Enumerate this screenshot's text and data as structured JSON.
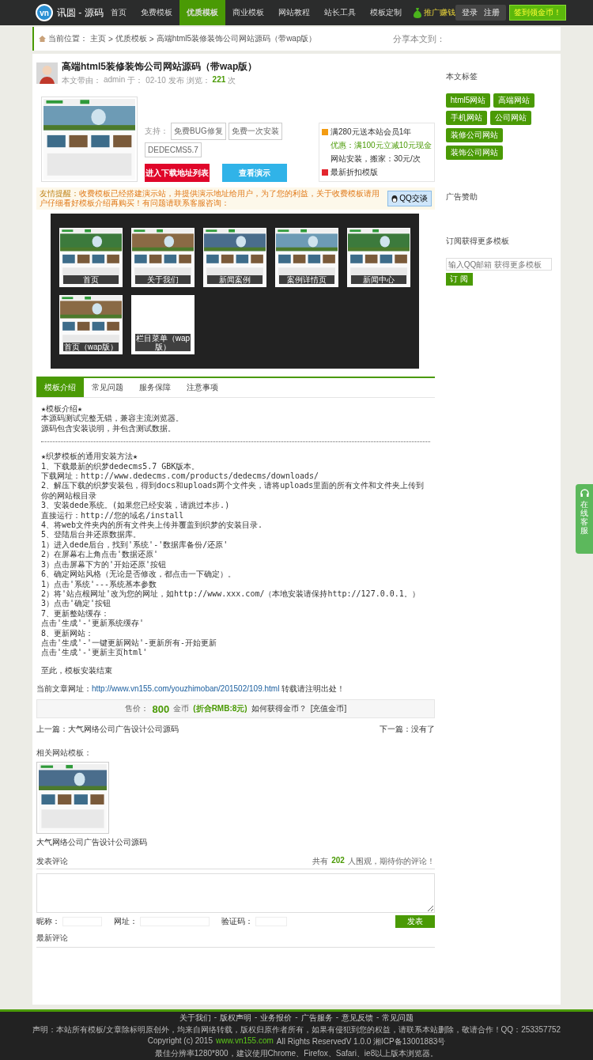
{
  "header": {
    "logo_mark": "vn",
    "logo_text": "讯圆 - 源码",
    "nav": [
      {
        "label": "首页",
        "selected": false
      },
      {
        "label": "免费模板",
        "selected": false
      },
      {
        "label": "优质模板",
        "selected": true
      },
      {
        "label": "商业模板",
        "selected": false
      },
      {
        "label": "网站教程",
        "selected": false
      },
      {
        "label": "站长工具",
        "selected": false
      },
      {
        "label": "模板定制",
        "selected": false
      }
    ],
    "promo": "推广赚钱",
    "login": "登录",
    "register": "注册",
    "signin": "签到领金币！"
  },
  "breadcrumb": {
    "label": "当前位置：",
    "separator": ">",
    "items": [
      "主页",
      "优质模板",
      "高端html5装修装饰公司网站源码（带wap版）"
    ],
    "share": "分享本文到："
  },
  "article": {
    "title": "高端html5装修装饰公司网站源码（带wap版）",
    "meta": {
      "author_label": "本文带由：",
      "author": "admin",
      "date_label": "于：",
      "date": "02-10 发布",
      "views_label": "浏览：",
      "views": "221",
      "views_unit": "次"
    },
    "support_label": "支持：",
    "support": [
      "免费BUG修复",
      "免费一次安装",
      "DEDECMS5.7"
    ],
    "download_button": "进入下载地址列表",
    "demo_button": "查看演示",
    "offers": [
      {
        "kind": "gift",
        "text": "满280元送本站会员1年"
      },
      {
        "kind": "highlight",
        "text": "优惠：满100元立减10元现金"
      },
      {
        "kind": "plain",
        "text": "网站安装，搬家：30元/次"
      },
      {
        "kind": "discount",
        "text": "最新折扣模版"
      }
    ],
    "notice": {
      "label": "友情提醒：",
      "text": "收费模板已经搭建演示站，并提供演示地址给用户，为了您的利益，关于收费模板请用户仔细看好模板介绍再购买！有问题请联系客服咨询：",
      "qq_button": "QQ交谈"
    },
    "gallery": [
      {
        "caption": "首页"
      },
      {
        "caption": "关于我们"
      },
      {
        "caption": "新闻案例"
      },
      {
        "caption": "案例详情页"
      },
      {
        "caption": "新闻中心"
      },
      {
        "caption": "首页（wap版）"
      },
      {
        "caption": "栏目菜单（wap版）"
      }
    ],
    "tabs": [
      {
        "label": "模板介绍",
        "selected": true
      },
      {
        "label": "常见问题",
        "selected": false
      },
      {
        "label": "服务保障",
        "selected": false
      },
      {
        "label": "注意事项",
        "selected": false
      }
    ],
    "content": [
      {
        "kind": "text",
        "text": "★模板介绍★"
      },
      {
        "kind": "text",
        "text": "本源码测试完整无错，兼容主流浏览器。"
      },
      {
        "kind": "text",
        "text": "源码包含安装说明，并包含测试数据。"
      },
      {
        "kind": "divider"
      },
      {
        "kind": "text",
        "text": "★织梦模板的通用安装方法★"
      },
      {
        "kind": "text",
        "text": "1、下载最新的织梦dedecms5.7 GBK版本。"
      },
      {
        "kind": "text",
        "text": "下载网址：http://www.dedecms.com/products/dedecms/downloads/"
      },
      {
        "kind": "text",
        "text": "2、解压下载的织梦安装包，得到docs和uploads两个文件夹，请将uploads里面的所有文件和文件夹上传到你的网站根目录"
      },
      {
        "kind": "text",
        "text": "3、安装dede系统。(如果您已经安装，请跳过本步.)"
      },
      {
        "kind": "text",
        "text": "直接运行：http://您的域名/install"
      },
      {
        "kind": "text",
        "text": "4、将web文件夹内的所有文件夹上传并覆盖到织梦的安装目录."
      },
      {
        "kind": "text",
        "text": "5、登陆后台并还原数据库。"
      },
      {
        "kind": "text",
        "text": "1）进入dede后台，找到'系统'-'数据库备份/还原'"
      },
      {
        "kind": "text",
        "text": "2）在屏幕右上角点击'数据还原'"
      },
      {
        "kind": "text",
        "text": "3）点击屏幕下方的'开始还原'按钮"
      },
      {
        "kind": "text",
        "text": "6、确定网站风格（无论是否修改，都点击一下确定）。"
      },
      {
        "kind": "text",
        "text": "1）点击'系统'---系统基本参数"
      },
      {
        "kind": "text",
        "text": "2）将'站点根网址'改为您的网址，如http://www.xxx.com/（本地安装请保持http://127.0.0.1。）"
      },
      {
        "kind": "text",
        "text": "3）点击'确定'按钮"
      },
      {
        "kind": "text",
        "text": "7、更新整站缓存："
      },
      {
        "kind": "text",
        "text": "点击'生成'-'更新系统缓存'"
      },
      {
        "kind": "text",
        "text": "8、更新网站："
      },
      {
        "kind": "text",
        "text": "点击'生成'-'一键更新网站'-更新所有-开始更新"
      },
      {
        "kind": "text",
        "text": "点击'生成'-'更新主页html'"
      },
      {
        "kind": "gap"
      },
      {
        "kind": "text",
        "text": "至此，模板安装结束"
      }
    ],
    "source": {
      "label": "当前文章网址：",
      "url": "http://www.vn155.com/youzhimoban/201502/109.html",
      "note": "转载请注明出处！"
    },
    "price": {
      "label": "售价：",
      "amount": "800",
      "unit": "金币",
      "rmb": "(折合RMB:8元)",
      "how": "如何获得金币？",
      "recharge": "[充值金币]"
    },
    "prev": "上一篇：大气网络公司广告设计公司源码",
    "next": "下一篇：没有了",
    "related": {
      "title": "相关网站模板：",
      "items": [
        {
          "caption": "大气网络公司广告设计公司源码"
        }
      ]
    },
    "comments": {
      "title": "发表评论",
      "count_prefix": "共有",
      "count": "202",
      "count_suffix": "人围观，期待你的评论！",
      "nickname_label": "昵称：",
      "site_label": "网址：",
      "code_label": "验证码：",
      "submit": "发表",
      "latest": "最新评论"
    }
  },
  "sidebar": {
    "tags_title": "本文标签",
    "tags": [
      "html5网站",
      "高端网站",
      "手机网站",
      "公司网站",
      "装修公司网站",
      "装饰公司网站"
    ],
    "ads_title": "广告赞助",
    "subscribe_title": "订阅获得更多模板",
    "subscribe_placeholder": "输入QQ邮箱 获得更多模板",
    "subscribe_button": "订 阅"
  },
  "float_tab": "在线客服",
  "footer": {
    "separator": "-",
    "links": [
      "关于我们",
      "版权声明",
      "业务报价",
      "广告服务",
      "意见反馈",
      "常见问题"
    ],
    "statement": "声明：本站所有模板/文章除标明原创外，均来自网络转载，版权归原作者所有，如果有侵犯到您的权益，请联系本站删除，敬请合作！QQ：253357752",
    "copyright_prefix": "Copyright (c) 2015",
    "copyright_link": "www.vn155.com",
    "copyright_suffix": "All Rights ReservedV 1.0.0   湘ICP备13001883号",
    "resolution": "最佳分辨率1280*800，建议使用Chrome、Firefox、Safari、ie8以上版本浏览器。"
  }
}
